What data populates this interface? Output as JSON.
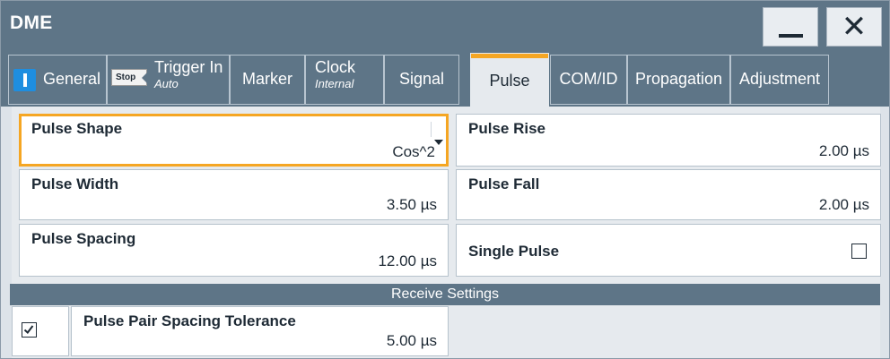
{
  "window": {
    "title": "DME"
  },
  "tabs": [
    {
      "id": "general",
      "label": "General"
    },
    {
      "id": "trigger",
      "label": "Trigger In",
      "sub": "Auto",
      "badge": "Stop"
    },
    {
      "id": "marker",
      "label": "Marker"
    },
    {
      "id": "clock",
      "label": "Clock",
      "sub": "Internal"
    },
    {
      "id": "signal",
      "label": "Signal"
    },
    {
      "id": "pulse",
      "label": "Pulse",
      "active": true
    },
    {
      "id": "comid",
      "label": "COM/ID"
    },
    {
      "id": "propagation",
      "label": "Propagation"
    },
    {
      "id": "adjustment",
      "label": "Adjustment"
    }
  ],
  "pulse": {
    "shape": {
      "label": "Pulse Shape",
      "value": "Cos^2"
    },
    "rise": {
      "label": "Pulse Rise",
      "value": "2.00 µs"
    },
    "width": {
      "label": "Pulse Width",
      "value": "3.50 µs"
    },
    "fall": {
      "label": "Pulse Fall",
      "value": "2.00 µs"
    },
    "spacing": {
      "label": "Pulse Spacing",
      "value": "12.00 µs"
    },
    "single": {
      "label": "Single Pulse",
      "checked": false
    }
  },
  "receive": {
    "section_title": "Receive Settings",
    "tolerance": {
      "label": "Pulse Pair Spacing Tolerance",
      "value": "5.00 µs",
      "enabled": true
    }
  },
  "colors": {
    "accent": "#f5a623",
    "titlebar": "#5e7587",
    "info_blue": "#1e8ee0"
  }
}
